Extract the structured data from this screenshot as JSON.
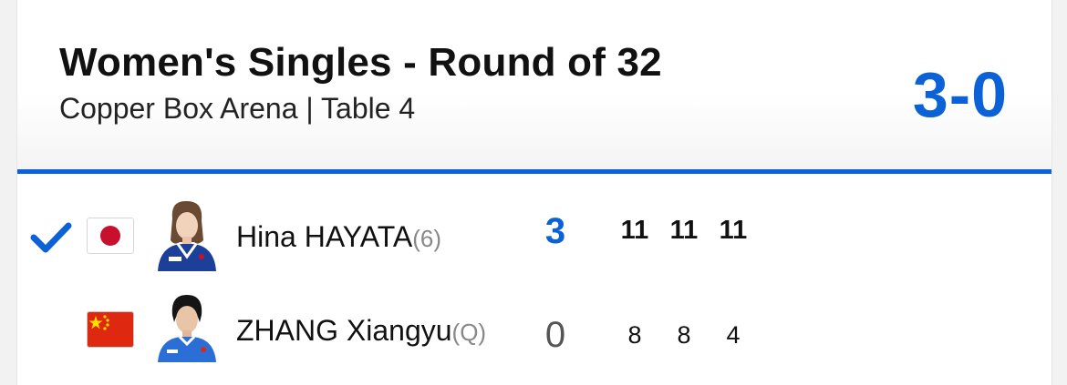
{
  "match": {
    "title": "Women's Singles - Round of 32",
    "venue": "Copper Box Arena | Table 4",
    "final_score": "3-0",
    "accent_color": "#0b62d6"
  },
  "players": [
    {
      "name": "Hina HAYATA",
      "seed": "(6)",
      "country_flag": "japan-flag",
      "winner": true,
      "sets_won": "3",
      "games": [
        "11",
        "11",
        "11"
      ]
    },
    {
      "name": "ZHANG Xiangyu",
      "seed": "(Q)",
      "country_flag": "china-flag",
      "winner": false,
      "sets_won": "0",
      "games": [
        "8",
        "8",
        "4"
      ]
    }
  ]
}
